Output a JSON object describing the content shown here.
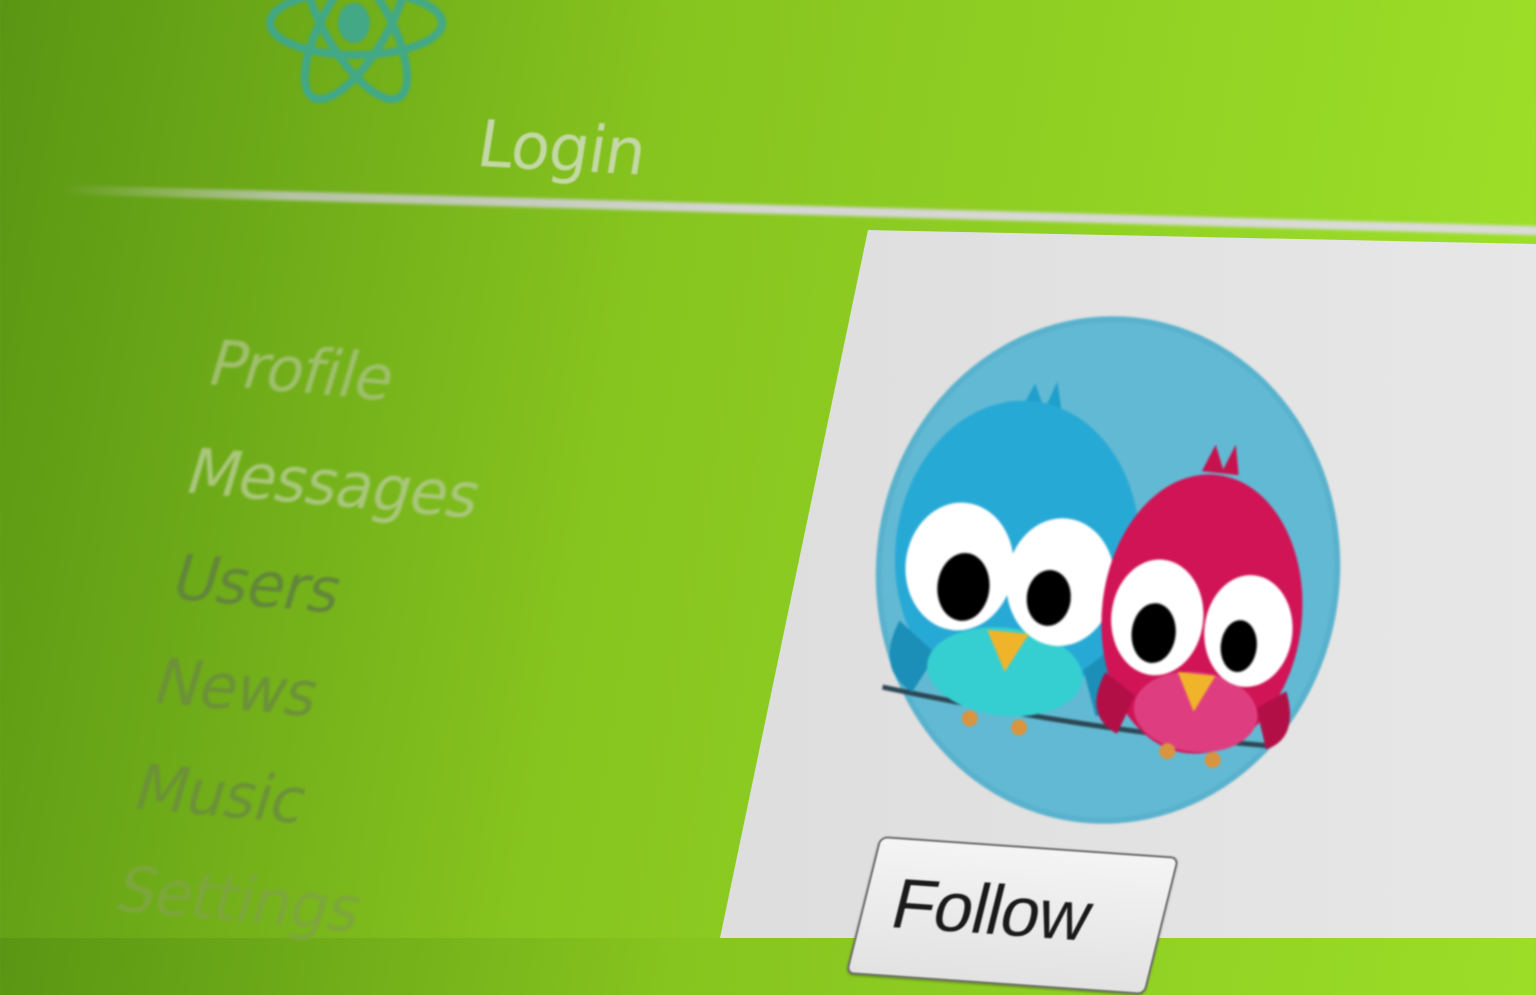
{
  "header": {
    "logo_icon": "react-atom-icon",
    "login_label": "Login"
  },
  "sidebar": {
    "items": [
      {
        "label": "Profile"
      },
      {
        "label": "Messages"
      },
      {
        "label": "Users"
      },
      {
        "label": "News"
      },
      {
        "label": "Music"
      },
      {
        "label": "Settings"
      }
    ]
  },
  "profile": {
    "avatar_icon": "two-birds-avatar",
    "follow_label": "Follow"
  },
  "colors": {
    "accent_green": "#8fd022",
    "logo_teal": "#3aa79a",
    "content_gray": "#dddddd"
  }
}
